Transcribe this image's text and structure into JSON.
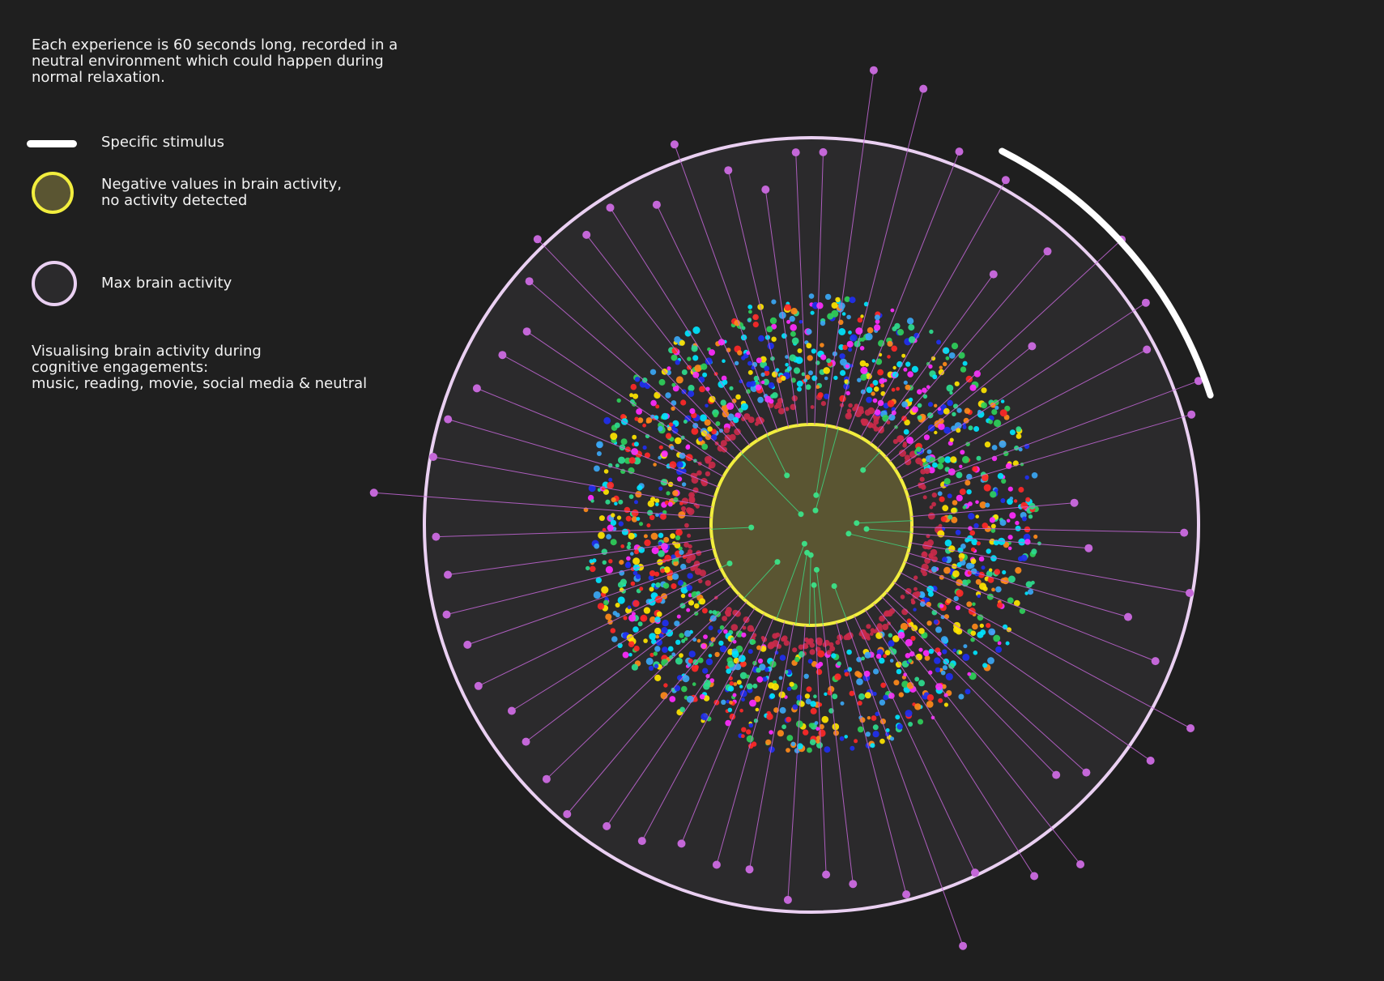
{
  "legend": {
    "intro": "Each experience is 60 seconds long, recorded in a\nneutral environment which could happen during\nnormal relaxation.",
    "stimulus_label": "Specific stimulus",
    "negative_label": "Negative values in brain activity,\nno activity detected",
    "max_label": "Max brain activity",
    "footer": "Visualising brain activity during\ncognitive engagements:\nmusic, reading, movie, social media & neutral"
  },
  "colors": {
    "background": "#1f1f1f",
    "plot_fill": "#2b2a2c",
    "max_ring": "#ead0f2",
    "negative_ring": "#f2ee3e",
    "negative_fill": "#5a5532",
    "stimulus_arc": "#ffffff",
    "outer_dot": "#c467d8",
    "inner_dot": "#3ddc84"
  },
  "chart_data": {
    "type": "scatter",
    "layout": "radial",
    "duration_seconds": 60,
    "angle_unit": "seconds",
    "radius_scale": {
      "negative": 0,
      "max": 1
    },
    "stimulus_range": [
      4.5,
      12.0
    ],
    "band_colors": [
      "#c92a4a",
      "#2edc8e",
      "#3ba7f5",
      "#ff2bff",
      "#ffe500",
      "#00e5ff",
      "#1f2ff0",
      "#ff8a1a",
      "#ff2828",
      "#2fcf5a"
    ],
    "outer_points": [
      [
        0.3,
        0.95
      ],
      [
        1.3,
        1.25
      ],
      [
        2.4,
        1.22
      ],
      [
        3.6,
        1.05
      ],
      [
        4.9,
        1.03
      ],
      [
        6.0,
        0.73
      ],
      [
        6.8,
        0.91
      ],
      [
        7.9,
        1.12
      ],
      [
        8.5,
        0.64
      ],
      [
        9.4,
        1.05
      ],
      [
        10.4,
        0.97
      ],
      [
        11.6,
        1.09
      ],
      [
        12.3,
        1.03
      ],
      [
        14.2,
        0.57
      ],
      [
        15.2,
        0.95
      ],
      [
        15.8,
        0.62
      ],
      [
        16.7,
        0.99
      ],
      [
        17.7,
        0.8
      ],
      [
        18.6,
        0.94
      ],
      [
        19.7,
        1.15
      ],
      [
        20.8,
        1.09
      ],
      [
        22.0,
        0.94
      ],
      [
        22.6,
        0.87
      ],
      [
        23.6,
        1.16
      ],
      [
        24.6,
        1.1
      ],
      [
        25.8,
        0.99
      ],
      [
        26.7,
        1.21
      ],
      [
        27.6,
        0.98
      ],
      [
        28.9,
        0.91
      ],
      [
        29.6,
        0.87
      ],
      [
        30.6,
        0.96
      ],
      [
        31.7,
        0.87
      ],
      [
        32.6,
        0.88
      ],
      [
        33.7,
        0.85
      ],
      [
        34.7,
        0.9
      ],
      [
        35.7,
        0.92
      ],
      [
        36.7,
        0.97
      ],
      [
        37.7,
        0.93
      ],
      [
        38.8,
        0.9
      ],
      [
        39.7,
        0.88
      ],
      [
        40.7,
        0.94
      ],
      [
        41.8,
        0.92
      ],
      [
        42.7,
        0.96
      ],
      [
        43.7,
        0.93
      ],
      [
        44.7,
        0.96
      ],
      [
        45.7,
        1.18
      ],
      [
        46.7,
        0.99
      ],
      [
        47.7,
        0.97
      ],
      [
        48.7,
        0.91
      ],
      [
        49.8,
        0.88
      ],
      [
        50.7,
        0.85
      ],
      [
        51.8,
        0.95
      ],
      [
        52.7,
        1.03
      ],
      [
        53.7,
        0.93
      ],
      [
        54.6,
        0.96
      ],
      [
        55.7,
        0.89
      ],
      [
        56.7,
        1.06
      ],
      [
        57.8,
        0.92
      ],
      [
        58.7,
        0.83
      ],
      [
        59.6,
        0.95
      ]
    ],
    "inner_points": [
      [
        1.5,
        -0.7
      ],
      [
        2.6,
        -0.85
      ],
      [
        7.2,
        -0.25
      ],
      [
        14.6,
        -0.55
      ],
      [
        15.7,
        -0.45
      ],
      [
        17.2,
        -0.62
      ],
      [
        26.6,
        -0.35
      ],
      [
        28.9,
        -0.55
      ],
      [
        29.6,
        -0.4
      ],
      [
        30.2,
        -0.7
      ],
      [
        31.5,
        -0.72
      ],
      [
        33.4,
        -0.8
      ],
      [
        37.1,
        -0.5
      ],
      [
        40.8,
        -0.1
      ],
      [
        44.6,
        -0.4
      ],
      [
        52.6,
        -0.85
      ],
      [
        55.6,
        -0.45
      ]
    ]
  }
}
